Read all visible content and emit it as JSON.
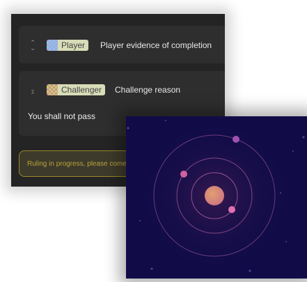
{
  "cards": [
    {
      "role": "Player",
      "title": "Player evidence of completion",
      "expanded": false
    },
    {
      "role": "Challenger",
      "title": "Challenge reason",
      "body": "You shall not pass",
      "expanded": true
    }
  ],
  "ruling": {
    "message": "Ruling in progress, please come back later"
  },
  "colors": {
    "accent_gold": "#b8a23a",
    "space_bg": "#110c48",
    "badge_bg": "#d8dcb8"
  },
  "icons": {
    "collapse": "chevron-up-down-icon",
    "illustration": "solar-system-illustration"
  }
}
